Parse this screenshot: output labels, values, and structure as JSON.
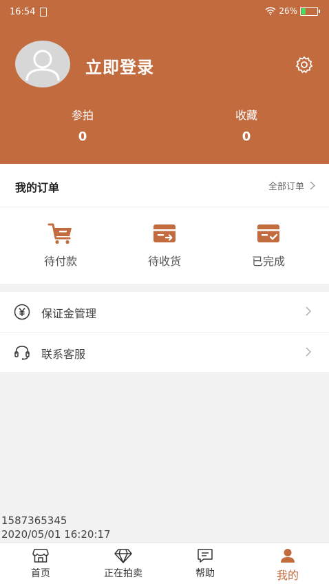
{
  "status_bar": {
    "time": "16:54",
    "battery": "26%",
    "battery_level": 0.26
  },
  "profile": {
    "login_label": "立即登录"
  },
  "stats": [
    {
      "label": "参拍",
      "value": "0"
    },
    {
      "label": "收藏",
      "value": "0"
    }
  ],
  "orders": {
    "title": "我的订单",
    "all_label": "全部订单",
    "items": [
      {
        "label": "待付款",
        "icon": "cart-icon"
      },
      {
        "label": "待收货",
        "icon": "delivery-box-icon"
      },
      {
        "label": "已完成",
        "icon": "completed-box-icon"
      }
    ]
  },
  "menu": [
    {
      "label": "保证金管理",
      "icon": "yuan-icon"
    },
    {
      "label": "联系客服",
      "icon": "headset-icon"
    }
  ],
  "device_info": {
    "line1": "1587365345",
    "line2": "2020/05/01 16:20:17"
  },
  "tabs": [
    {
      "label": "首页",
      "icon": "store-icon"
    },
    {
      "label": "正在拍卖",
      "icon": "diamond-icon"
    },
    {
      "label": "帮助",
      "icon": "message-icon"
    },
    {
      "label": "我的",
      "icon": "person-icon",
      "active": true
    }
  ],
  "colors": {
    "brand": "#c26b3e",
    "background": "#f2f2f2",
    "battery": "#4cd964"
  }
}
